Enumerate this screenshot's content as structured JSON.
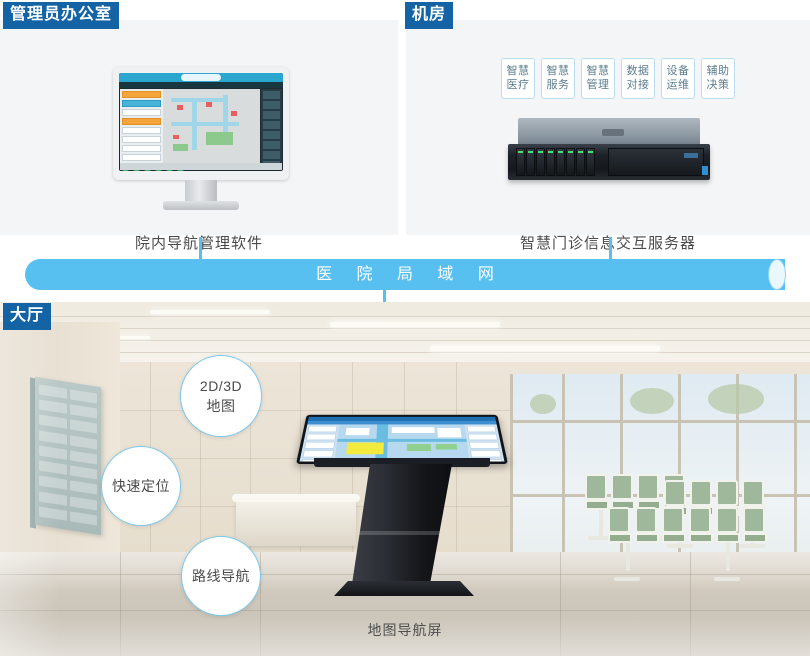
{
  "sections": {
    "admin_office": {
      "label": "管理员办公室",
      "caption": "院内导航管理软件",
      "device": "desktop-monitor"
    },
    "machine_room": {
      "label": "机房",
      "caption": "智慧门诊信息交互服务器",
      "device": "rack-server",
      "tags": [
        {
          "line1": "智慧",
          "line2": "医疗"
        },
        {
          "line1": "智慧",
          "line2": "服务"
        },
        {
          "line1": "智慧",
          "line2": "管理"
        },
        {
          "line1": "数据",
          "line2": "对接"
        },
        {
          "line1": "设备",
          "line2": "运维"
        },
        {
          "line1": "辅助",
          "line2": "决策"
        }
      ]
    },
    "hall": {
      "label": "大厅",
      "caption": "地图导航屏",
      "features": [
        {
          "line1": "2D/3D",
          "line2": "地图"
        },
        {
          "line1": "快速定位",
          "line2": ""
        },
        {
          "line1": "路线导航",
          "line2": ""
        }
      ]
    }
  },
  "network": {
    "label": "医 院 局 域 网"
  },
  "colors": {
    "label_blue": "#1464a5",
    "network_blue": "#57c0f0",
    "tag_border": "#bcdcef",
    "tag_text": "#5c7c8e",
    "circle_border": "#7ec8ec",
    "panel_bg": "#f4f5f6"
  }
}
